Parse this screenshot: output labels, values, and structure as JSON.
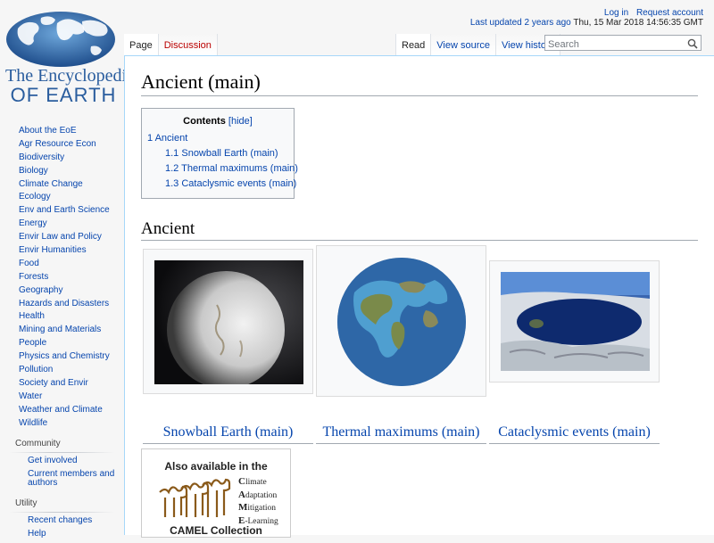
{
  "logo": {
    "line1": "The Encyclopedia",
    "line2": "OF EARTH"
  },
  "sidebar": {
    "items": [
      {
        "label": "About the EoE"
      },
      {
        "label": "Agr Resource Econ"
      },
      {
        "label": "Biodiversity"
      },
      {
        "label": "Biology"
      },
      {
        "label": "Climate Change"
      },
      {
        "label": "Ecology"
      },
      {
        "label": "Env and Earth Science"
      },
      {
        "label": "Energy"
      },
      {
        "label": "Envir Law and Policy"
      },
      {
        "label": "Envir Humanities"
      },
      {
        "label": "Food"
      },
      {
        "label": "Forests"
      },
      {
        "label": "Geography"
      },
      {
        "label": "Hazards and Disasters"
      },
      {
        "label": "Health"
      },
      {
        "label": "Mining and Materials"
      },
      {
        "label": "People"
      },
      {
        "label": "Physics and Chemistry"
      },
      {
        "label": "Pollution"
      },
      {
        "label": "Society and Envir"
      },
      {
        "label": "Water"
      },
      {
        "label": "Weather and Climate"
      },
      {
        "label": "Wildlife"
      }
    ],
    "community": {
      "heading": "Community",
      "items": [
        {
          "label": "Get involved"
        },
        {
          "label": "Current members and authors"
        }
      ]
    },
    "utility": {
      "heading": "Utility",
      "items": [
        {
          "label": "Recent changes"
        },
        {
          "label": "Help"
        }
      ]
    }
  },
  "personal": {
    "login": "Log in",
    "request": "Request account"
  },
  "updated": {
    "link": "Last updated 2 years ago",
    "timestamp": "Thu, 15 Mar 2018 14:56:35 GMT"
  },
  "tabs": {
    "page": "Page",
    "discussion": "Discussion",
    "read": "Read",
    "view_source": "View source",
    "view_history": "View history"
  },
  "search": {
    "placeholder": "Search",
    "icon": "search-icon"
  },
  "page": {
    "title": "Ancient (main)"
  },
  "toc": {
    "title": "Contents",
    "toggle": "[hide]",
    "items": [
      {
        "num": "1",
        "label": "Ancient"
      },
      {
        "num": "1.1",
        "label": "Snowball Earth (main)"
      },
      {
        "num": "1.2",
        "label": "Thermal maximums (main)"
      },
      {
        "num": "1.3",
        "label": "Cataclysmic events (main)"
      }
    ]
  },
  "section": {
    "heading": "Ancient"
  },
  "gallery": {
    "captions": [
      "Snowball Earth (main)",
      "Thermal maximums (main)",
      "Cataclysmic events (main)"
    ]
  },
  "camel": {
    "title": "Also available in the",
    "acronym": [
      {
        "initial": "C",
        "rest": "limate"
      },
      {
        "initial": "A",
        "rest": "daptation"
      },
      {
        "initial": "M",
        "rest": "itigation"
      },
      {
        "initial": "E",
        "rest": "-Learning"
      }
    ],
    "footer": "CAMEL Collection"
  },
  "colors": {
    "link": "#0645ad",
    "new_link": "#ba0000",
    "border": "#a7d7f9"
  }
}
